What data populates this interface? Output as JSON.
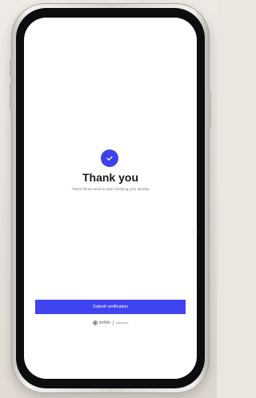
{
  "confirmation": {
    "title": "Thank you",
    "message": "That's all we need to start verifying your identity"
  },
  "actions": {
    "submit_label": "Submit verification"
  },
  "footer": {
    "brand_name": "onfido",
    "brand_tagline": "Real Identity"
  },
  "icons": {
    "success": "checkmark-icon",
    "brand": "onfido-logo-icon"
  },
  "colors": {
    "accent": "#3f43f0",
    "title": "#1a1a1a",
    "screen_background": "#ffffff"
  }
}
